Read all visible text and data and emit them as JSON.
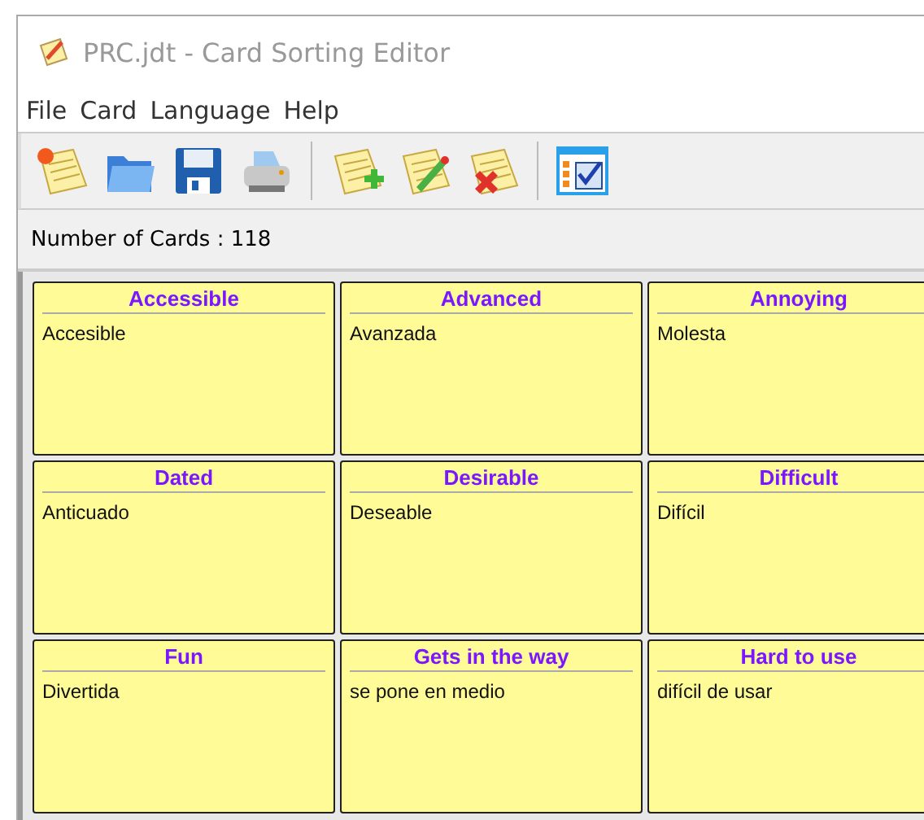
{
  "window": {
    "title": "PRC.jdt - Card Sorting Editor"
  },
  "menu": [
    "File",
    "Card",
    "Language",
    "Help"
  ],
  "toolbar": [
    {
      "kind": "new"
    },
    {
      "kind": "open"
    },
    {
      "kind": "save"
    },
    {
      "kind": "print"
    },
    {
      "kind": "separator"
    },
    {
      "kind": "add"
    },
    {
      "kind": "edit"
    },
    {
      "kind": "delete"
    },
    {
      "kind": "separator"
    },
    {
      "kind": "checklist"
    }
  ],
  "status": "Number of Cards : 118",
  "cards": [
    {
      "term": "Accessible",
      "translation": "Accesible"
    },
    {
      "term": "Advanced",
      "translation": "Avanzada"
    },
    {
      "term": "Annoying",
      "translation": "Molesta"
    },
    {
      "term": "Dated",
      "translation": "Anticuado"
    },
    {
      "term": "Desirable",
      "translation": "Deseable"
    },
    {
      "term": "Difficult",
      "translation": "Difícil"
    },
    {
      "term": "Fun",
      "translation": "Divertida"
    },
    {
      "term": "Gets in the way",
      "translation": "se pone en medio"
    },
    {
      "term": "Hard to use",
      "translation": "difícil de usar"
    }
  ]
}
